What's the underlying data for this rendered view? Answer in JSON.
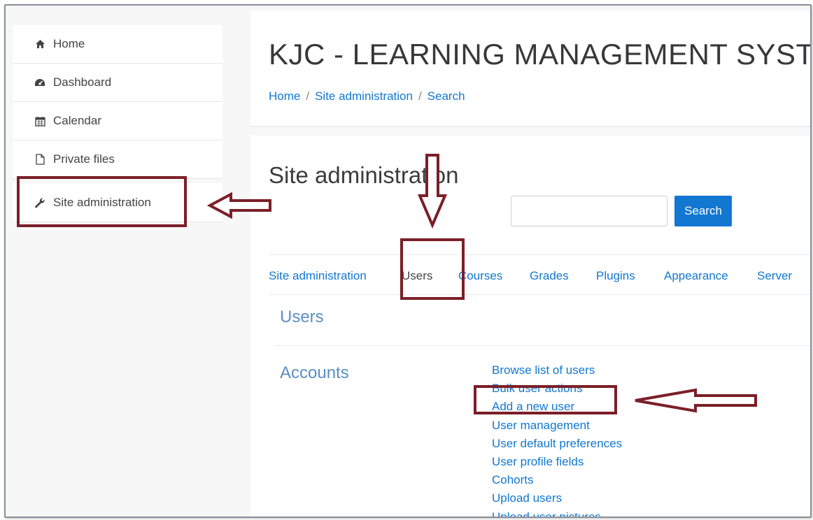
{
  "sidebar": {
    "items": [
      {
        "label": "Home",
        "icon": "home-icon"
      },
      {
        "label": "Dashboard",
        "icon": "dashboard-icon"
      },
      {
        "label": "Calendar",
        "icon": "calendar-icon"
      },
      {
        "label": "Private files",
        "icon": "file-icon"
      },
      {
        "label": "Site administration",
        "icon": "wrench-icon"
      }
    ]
  },
  "header": {
    "site_title": "KJC - LEARNING MANAGEMENT SYSTEM",
    "breadcrumb": [
      "Home",
      "Site administration",
      "Search"
    ],
    "breadcrumb_separator": "/"
  },
  "main": {
    "heading": "Site administration",
    "search": {
      "value": "",
      "button_label": "Search"
    },
    "tabs": [
      {
        "label": "Site administration",
        "active": false
      },
      {
        "label": "Users",
        "active": true
      },
      {
        "label": "Courses",
        "active": false
      },
      {
        "label": "Grades",
        "active": false
      },
      {
        "label": "Plugins",
        "active": false
      },
      {
        "label": "Appearance",
        "active": false
      },
      {
        "label": "Server",
        "active": false
      }
    ],
    "section_title": "Users",
    "accounts": {
      "label": "Accounts",
      "links": [
        "Browse list of users",
        "Bulk user actions",
        "Add a new user",
        "User management",
        "User default preferences",
        "User profile fields",
        "Cohorts",
        "Upload users",
        "Upload user pictures"
      ]
    }
  },
  "colors": {
    "link": "#1177d1",
    "section": "#5b8ec4",
    "annotation": "#7b1f28",
    "button": "#1177d1"
  }
}
